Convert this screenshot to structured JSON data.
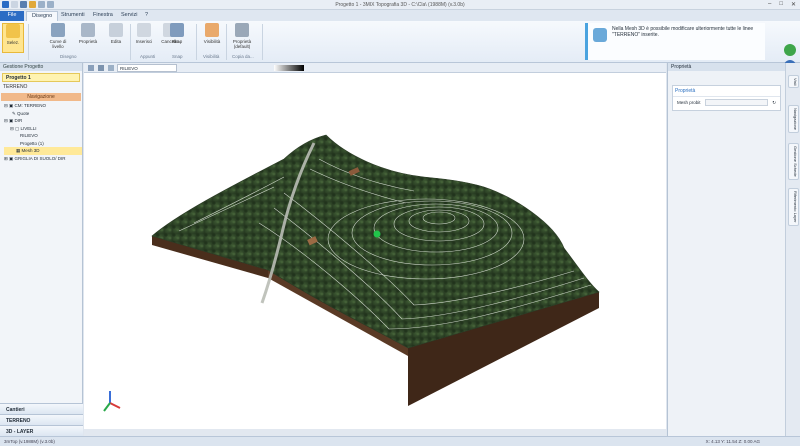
{
  "window": {
    "title": "Progetto 1 - 3MIX Topografia 3D - C:\\Cla\\ (1988M) (v.3.0b)"
  },
  "tabs": [
    {
      "label": "File"
    },
    {
      "label": "Disegno"
    },
    {
      "label": "Strumenti"
    },
    {
      "label": "Finestra"
    },
    {
      "label": "Servizi"
    }
  ],
  "ribbon": {
    "select": "Selez.",
    "curve": "Curve di livello",
    "proprieta": "Proprietà",
    "edita": "Edita",
    "inserisci": "Inserisci",
    "cancella": "Cancella",
    "snap": "Snap",
    "visibilita": "Visibilità",
    "prop_default": "Proprietà (default)",
    "groups": [
      "Disegno",
      "Appunti",
      "Snap",
      "Visibilità",
      "Copia da..."
    ],
    "note": "Nella Mesh 3D è possibile modificare ulteriormente tutte le linee \"TERRENO\" inserite."
  },
  "left_panel": {
    "header": "Gestione Progetto",
    "project": "Progetto 1",
    "terrain": "TERRENO",
    "nav_label": "Navigazione",
    "tree": [
      "CM: TERRENO",
      "Quote",
      "DIR",
      "LIVELLI",
      "RILIEVO",
      "Progetto (1)",
      "Mesh 3D",
      "GRIGLIA DI SUOLO/ DIR"
    ],
    "bottom": [
      "Cantieri",
      "TERRENO",
      "3D - LAYER"
    ]
  },
  "viewport": {
    "view_combo": "RILIEVO"
  },
  "right_panel": {
    "header": "Proprietà",
    "section": "Proprietà",
    "field_label": "Mesh probit"
  },
  "vtabs": [
    "Visti",
    "Navigazione",
    "Gestione Schede",
    "Riferimento Layer"
  ],
  "status": {
    "left": "3mTop (v.1988M) (v.3.0b)",
    "right": "X: 4.13 Y: 11.54 Z: 0.00 AG"
  },
  "colors": {
    "accent": "#2b6cc4",
    "terrain_canopy": "#2f4a2a",
    "terrain_soil": "#4a2e1c",
    "marker": "#21c44a"
  }
}
